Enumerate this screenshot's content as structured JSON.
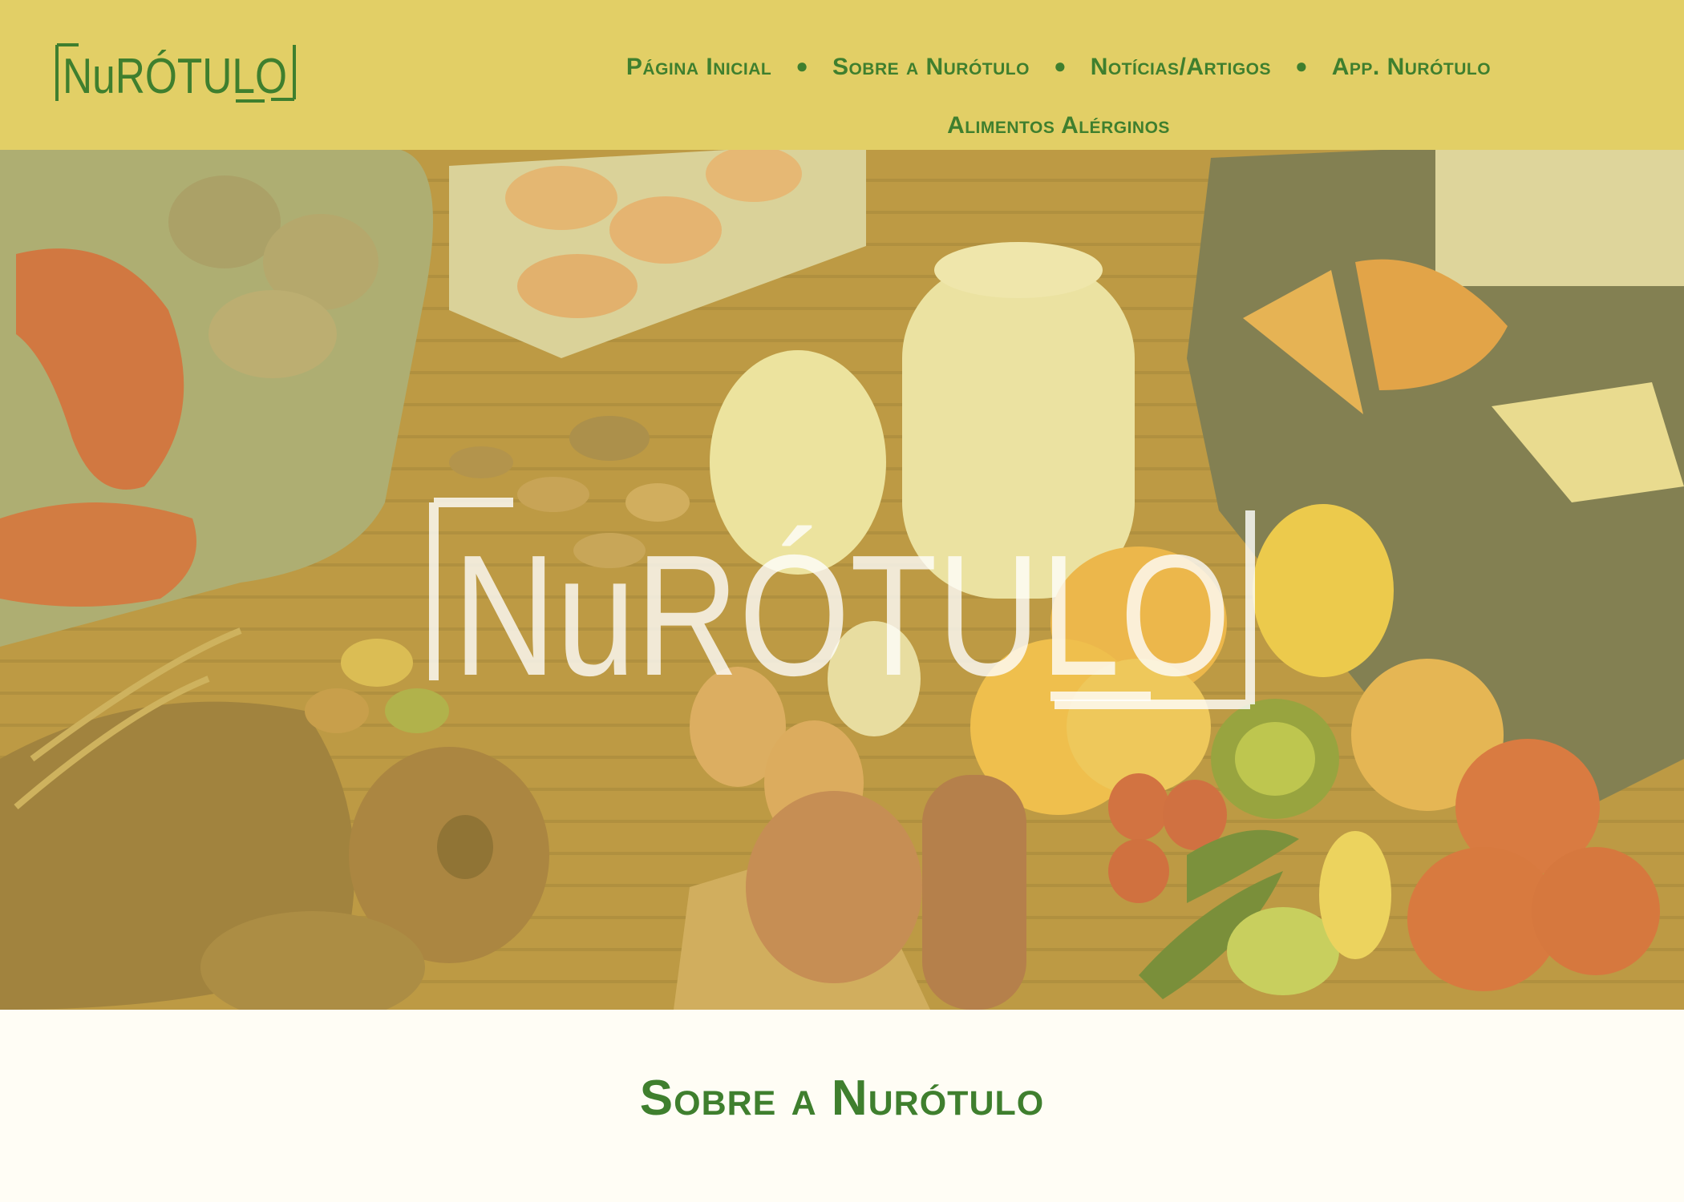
{
  "brand": {
    "name": "NuRÓTULO",
    "color_primary": "#3f7f2e",
    "color_header": "#e2cf66"
  },
  "nav": {
    "items": [
      {
        "label": "Página Inicial"
      },
      {
        "label": "Sobre a Nurótulo"
      },
      {
        "label": "Notícias/Artigos"
      },
      {
        "label": "App. Nurótulo"
      },
      {
        "label": "Alimentos Alérginos"
      }
    ],
    "separator": "●"
  },
  "hero": {
    "logo_text": "NuRÓTULO"
  },
  "section": {
    "title": "Sobre a Nurótulo"
  }
}
